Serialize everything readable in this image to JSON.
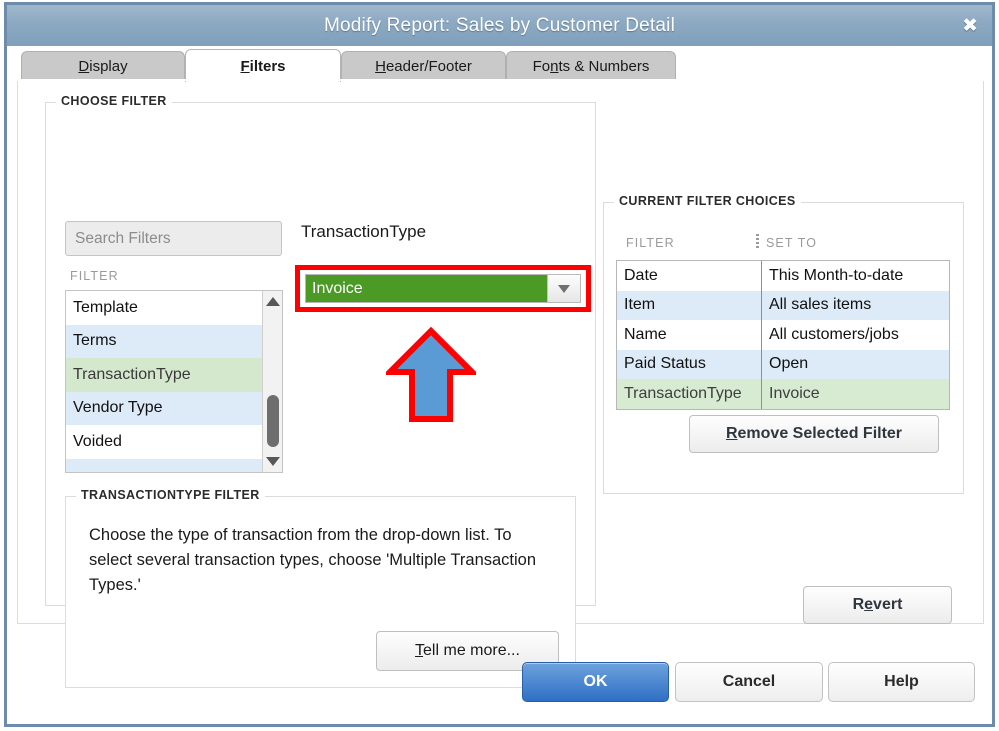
{
  "window": {
    "title": "Modify Report: Sales by Customer Detail",
    "close_icon": "close-icon",
    "close_glyph": "✖"
  },
  "tabs": [
    {
      "label": "Display",
      "mnemonic": "D",
      "active": false
    },
    {
      "label": "Filters",
      "mnemonic": "F",
      "active": true
    },
    {
      "label": "Header/Footer",
      "mnemonic": "H",
      "active": false
    },
    {
      "label": "Fonts & Numbers",
      "mnemonic": "n",
      "active": false
    }
  ],
  "choose_filter": {
    "group_label": "CHOOSE FILTER",
    "search": {
      "value": "",
      "placeholder": "Search Filters"
    },
    "list_header": "FILTER",
    "items": [
      {
        "label": "Template",
        "selected": false
      },
      {
        "label": "Terms",
        "selected": false
      },
      {
        "label": "TransactionType",
        "selected": true
      },
      {
        "label": "Vendor Type",
        "selected": false
      },
      {
        "label": "Voided",
        "selected": false
      },
      {
        "label": "",
        "selected": false
      }
    ],
    "scrollbar": {
      "up_icon": "triangle-up-icon",
      "down_icon": "triangle-down-icon"
    },
    "selected_filter_heading": "TransactionType",
    "dropdown": {
      "value": "Invoice",
      "arrow_icon": "chevron-down-icon"
    }
  },
  "annotations": {
    "highlight_box_color": "#ff0000",
    "arrow_fill": "#5b9bd5",
    "arrow_stroke": "#ff0000"
  },
  "description_panel": {
    "group_label": "TRANSACTIONTYPE FILTER",
    "text": "Choose the type of transaction from the drop-down list. To select several transaction types, choose 'Multiple Transaction Types.'",
    "tell_me_more": {
      "label": "Tell me more...",
      "mnemonic": "T"
    }
  },
  "current_filter_choices": {
    "group_label": "CURRENT FILTER CHOICES",
    "columns": [
      "FILTER",
      "SET TO"
    ],
    "resize_handle_icon": "column-resize-icon",
    "rows": [
      {
        "filter": "Date",
        "set_to": "This Month-to-date",
        "selected": false
      },
      {
        "filter": "Item",
        "set_to": "All sales items",
        "selected": false
      },
      {
        "filter": "Name",
        "set_to": "All customers/jobs",
        "selected": false
      },
      {
        "filter": "Paid Status",
        "set_to": "Open",
        "selected": false
      },
      {
        "filter": "TransactionType",
        "set_to": "Invoice",
        "selected": true
      }
    ],
    "remove_button": {
      "label": "Remove Selected Filter",
      "mnemonic": "R"
    }
  },
  "revert_button": {
    "label": "Revert",
    "mnemonic": "e"
  },
  "footer": {
    "ok": "OK",
    "cancel": "Cancel",
    "help": "Help"
  }
}
